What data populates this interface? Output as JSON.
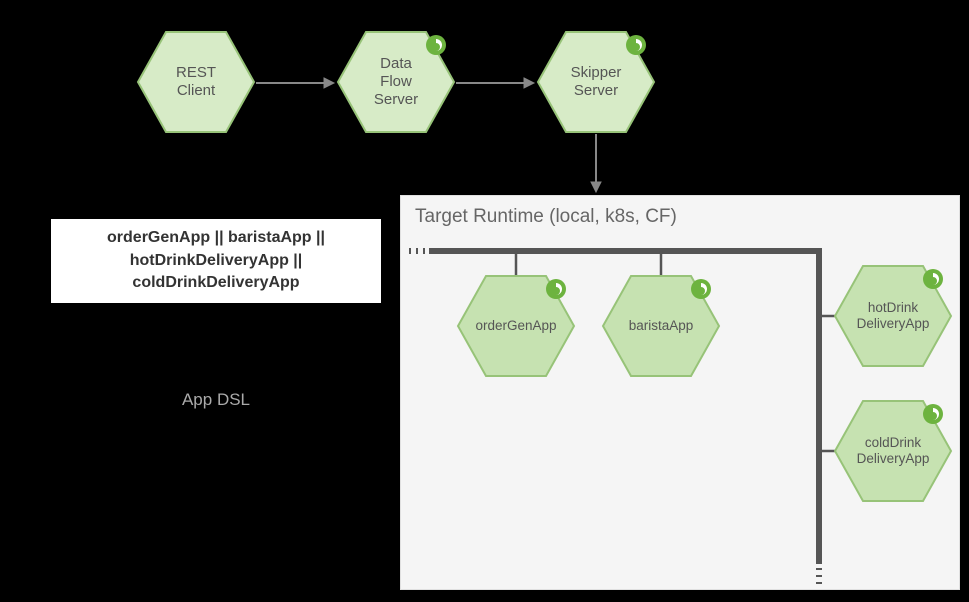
{
  "topRow": {
    "restClient": "REST\nClient",
    "dataFlowServer": "Data\nFlow\nServer",
    "skipperServer": "Skipper\nServer"
  },
  "dsl": {
    "text": "orderGenApp || baristaApp || hotDrinkDeliveryApp || coldDrinkDeliveryApp",
    "caption": "App DSL"
  },
  "targetRuntime": {
    "title": "Target Runtime (local, k8s, CF)",
    "apps": {
      "orderGenApp": "orderGenApp",
      "baristaApp": "baristaApp",
      "hotDrinkDeliveryApp": "hotDrink\nDeliveryApp",
      "coldDrinkDeliveryApp": "coldDrink\nDeliveryApp"
    }
  },
  "colors": {
    "hexFillLight": "#d7ebc7",
    "hexFillMid": "#c6e2b1",
    "hexStroke": "#97c378",
    "springGreen": "#6db33f",
    "pipe": "#555555"
  }
}
